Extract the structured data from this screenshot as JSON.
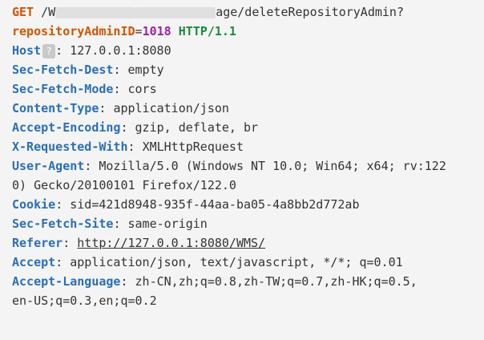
{
  "request_line": {
    "method": "GET",
    "path_start": "/W",
    "path_end": "age/deleteRepositoryAdmin?",
    "param_key": "repositoryAdminID",
    "param_value": "1018",
    "protocol": "HTTP/1.1"
  },
  "headers": {
    "host": {
      "name": "Host",
      "value": "127.0.0.1:8080"
    },
    "sec_fetch_dest": {
      "name": "Sec-Fetch-Dest",
      "value": "empty"
    },
    "sec_fetch_mode": {
      "name": "Sec-Fetch-Mode",
      "value": "cors"
    },
    "content_type": {
      "name": "Content-Type",
      "value": "application/json"
    },
    "accept_encoding": {
      "name": "Accept-Encoding",
      "value": "gzip, deflate, br"
    },
    "x_requested_with": {
      "name": "X-Requested-With",
      "value": "XMLHttpRequest"
    },
    "user_agent": {
      "name": "User-Agent",
      "value": "Mozilla/5.0 (Windows NT 10.0; Win64; x64; rv:122",
      "cont": "0) Gecko/20100101 Firefox/122.0"
    },
    "cookie": {
      "name": "Cookie",
      "value": "sid=421d8948-935f-44aa-ba05-4a8bb2d772ab"
    },
    "sec_fetch_site": {
      "name": "Sec-Fetch-Site",
      "value": "same-origin"
    },
    "referer": {
      "name": "Referer",
      "value": "http://127.0.0.1:8080/WMS/"
    },
    "accept": {
      "name": "Accept",
      "value": "application/json, text/javascript, */*; q=0.01"
    },
    "accept_language": {
      "name": "Accept-Language",
      "value": "zh-CN,zh;q=0.8,zh-TW;q=0.7,zh-HK;q=0.5,",
      "cont": "en-US;q=0.3,en;q=0.2"
    }
  },
  "icons": {
    "host_badge": "?"
  }
}
